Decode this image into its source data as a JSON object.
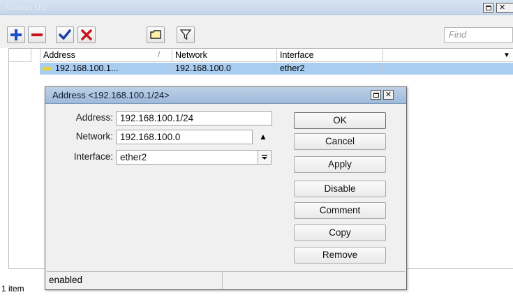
{
  "window": {
    "title": "Address List"
  },
  "toolbar": {
    "buttons": [
      {
        "icon": "plus-icon",
        "label": "Add"
      },
      {
        "icon": "minus-icon",
        "label": "Remove"
      },
      {
        "icon": "check-icon",
        "label": "Enable"
      },
      {
        "icon": "cross-icon",
        "label": "Disable"
      },
      {
        "icon": "comment-icon",
        "label": "Comment"
      },
      {
        "icon": "filter-icon",
        "label": "Filter"
      }
    ],
    "find_placeholder": "Find"
  },
  "table": {
    "columns": [
      "Address",
      "Network",
      "Interface"
    ],
    "sort_indicator": "/",
    "rows": [
      {
        "address": "192.168.100.1...",
        "network": "192.168.100.0",
        "interface": "ether2"
      }
    ],
    "status": "1 item"
  },
  "dialog": {
    "title": "Address <192.168.100.1/24>",
    "fields": {
      "address_label": "Address:",
      "address_value": "192.168.100.1/24",
      "network_label": "Network:",
      "network_value": "192.168.100.0",
      "interface_label": "Interface:",
      "interface_value": "ether2"
    },
    "buttons": {
      "ok": "OK",
      "cancel": "Cancel",
      "apply": "Apply",
      "disable": "Disable",
      "comment": "Comment",
      "copy": "Copy",
      "remove": "Remove"
    },
    "status": "enabled"
  },
  "colors": {
    "selection_row": "#a9cdf0",
    "title_bar": "#c5d6ea",
    "add_blue": "#1c4fc4",
    "remove_red": "#c8161d",
    "check_blue": "#1a3ea8"
  }
}
